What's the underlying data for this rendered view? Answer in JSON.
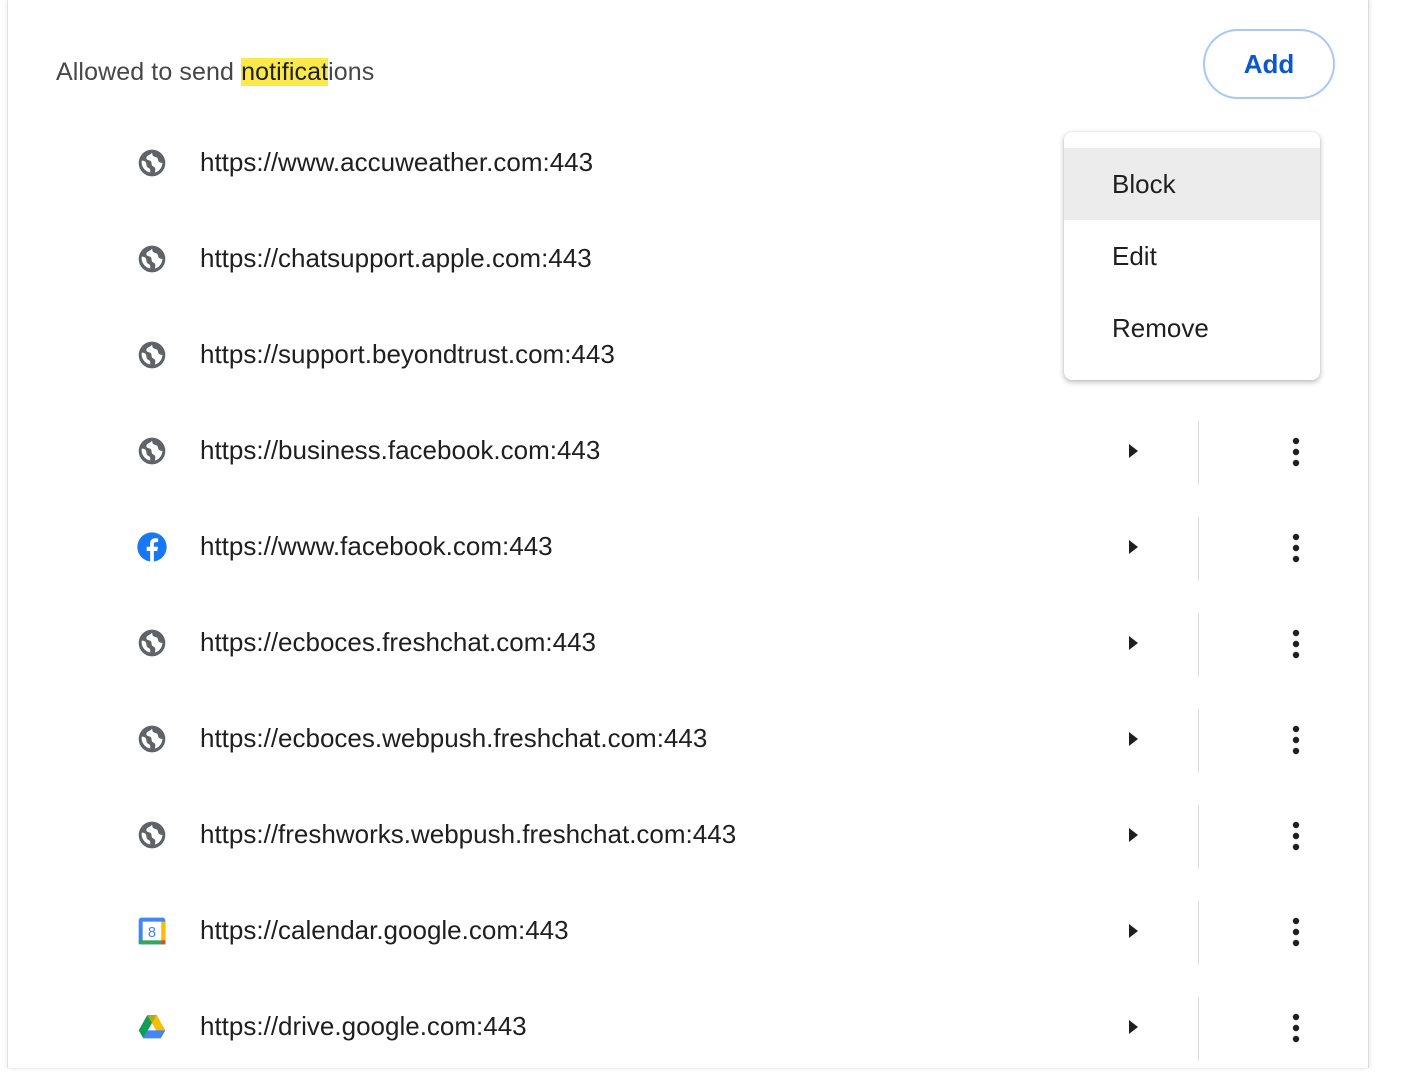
{
  "section": {
    "label_before": "Allowed to send ",
    "label_highlight": "notificat",
    "label_after": "ions",
    "add_label": "Add"
  },
  "sites": [
    {
      "url": "https://www.accuweather.com:443",
      "icon": "globe-icon"
    },
    {
      "url": "https://chatsupport.apple.com:443",
      "icon": "globe-icon"
    },
    {
      "url": "https://support.beyondtrust.com:443",
      "icon": "globe-icon"
    },
    {
      "url": "https://business.facebook.com:443",
      "icon": "globe-icon"
    },
    {
      "url": "https://www.facebook.com:443",
      "icon": "facebook-icon"
    },
    {
      "url": "https://ecboces.freshchat.com:443",
      "icon": "globe-icon"
    },
    {
      "url": "https://ecboces.webpush.freshchat.com:443",
      "icon": "globe-icon"
    },
    {
      "url": "https://freshworks.webpush.freshchat.com:443",
      "icon": "globe-icon"
    },
    {
      "url": "https://calendar.google.com:443",
      "icon": "google-calendar-icon"
    },
    {
      "url": "https://drive.google.com:443",
      "icon": "google-drive-icon"
    }
  ],
  "calendar_icon_day": "8",
  "menu": {
    "items": [
      "Block",
      "Edit",
      "Remove"
    ],
    "highlighted": "Block"
  },
  "colors": {
    "accent": "#0b57d0",
    "add_border": "#a8c7fa",
    "highlight": "#fbe94a",
    "icon_gray": "#5f6368",
    "facebook_blue": "#1877f2"
  }
}
